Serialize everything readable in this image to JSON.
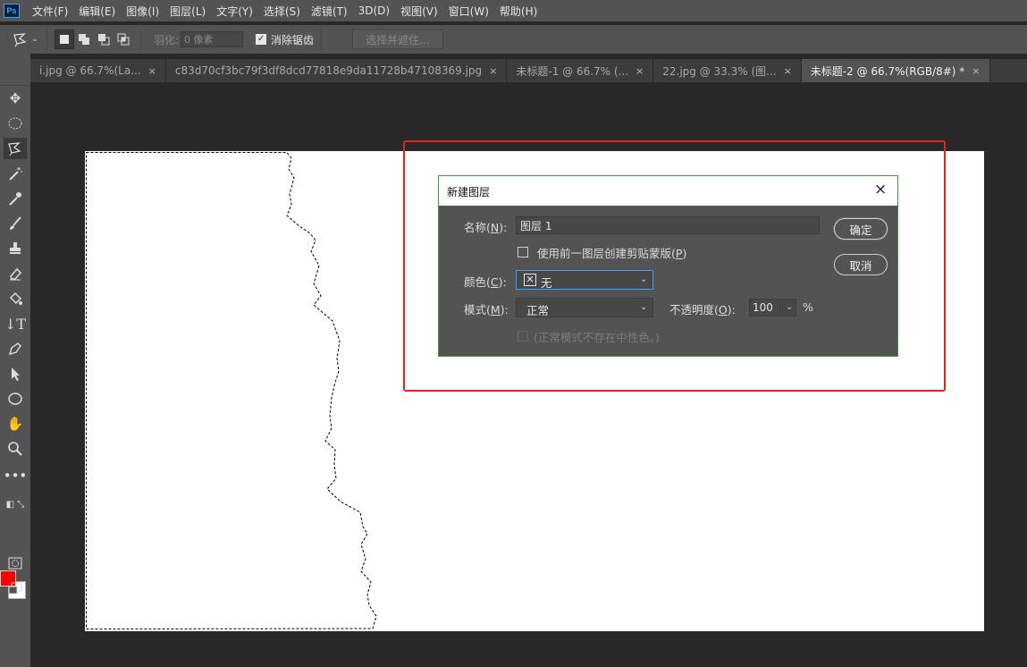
{
  "app": {
    "logo": "Ps"
  },
  "menu": [
    "文件(F)",
    "编辑(E)",
    "图像(I)",
    "图层(L)",
    "文字(Y)",
    "选择(S)",
    "滤镜(T)",
    "3D(D)",
    "视图(V)",
    "窗口(W)",
    "帮助(H)"
  ],
  "options": {
    "tool_icon": "lasso-icon",
    "feather_label": "羽化:",
    "feather_value": "0 像素",
    "antialias_label": "消除锯齿",
    "antialias_checked": true,
    "select_mask_label": "选择并遮住..."
  },
  "tabs": [
    {
      "label": "i.jpg @ 66.7%(La...",
      "active": false
    },
    {
      "label": "c83d70cf3bc79f3df8dcd77818e9da11728b47108369.jpg",
      "active": false
    },
    {
      "label": "未标题-1 @ 66.7% (...",
      "active": false
    },
    {
      "label": "22.jpg @ 33.3% (图...",
      "active": false
    },
    {
      "label": "未标题-2 @ 66.7%(RGB/8#) *",
      "active": true
    }
  ],
  "tab_close": "×",
  "colors": {
    "foreground": "#ff0000",
    "background": "#ffffff",
    "highlight": "#e1251b"
  },
  "dialog": {
    "title": "新建图层",
    "close_icon": "×",
    "name_label": "名称(",
    "name_key": "N",
    "name_label_end": "):",
    "name_value": "图层 1",
    "clip_label": "使用前一图层创建剪贴蒙版(",
    "clip_key": "P",
    "clip_label_end": ")",
    "color_label": "颜色(",
    "color_key": "C",
    "color_label_end": "):",
    "color_value": "无",
    "mode_label": "模式(",
    "mode_key": "M",
    "mode_label_end": "):",
    "mode_value": "正常",
    "opacity_label": "不透明度(",
    "opacity_key": "O",
    "opacity_label_end": "):",
    "opacity_value": "100",
    "opacity_unit": "%",
    "neutral_label": "(正常模式不存在中性色。)",
    "ok_label": "确定",
    "cancel_label": "取消"
  }
}
